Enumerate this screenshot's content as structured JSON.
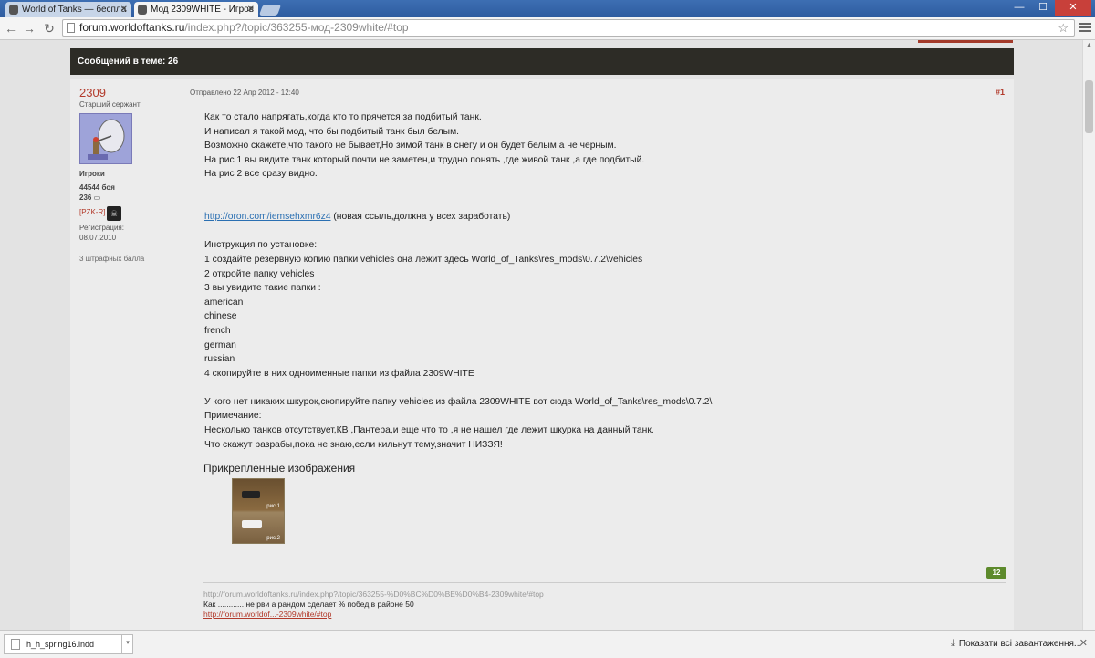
{
  "browser": {
    "tabs": [
      {
        "title": "World of Tanks — беспла",
        "active": false
      },
      {
        "title": "Мод 2309WHITE - Игров",
        "active": true
      }
    ],
    "url_domain": "forum.worldoftanks.ru",
    "url_path": "/index.php?/topic/363255-мод-2309white/#top",
    "window_controls": {
      "minimize": "—",
      "maximize": "☐",
      "close": "✕"
    }
  },
  "topic_header": {
    "replies_label": "Сообщений в теме: 26"
  },
  "post": {
    "author": "2309",
    "rank": "Старший сержант",
    "group": "Игроки",
    "battles": "44544 боя",
    "posts_count": "236",
    "clan_tag": "[PZK-R]",
    "clan_logo": "☠",
    "registered_label": "Регистрация:",
    "registered_date": "08.07.2010",
    "penalty": "3 штрафных балла",
    "posted": "Отправлено 22 Апр 2012 - 12:40",
    "number": "#1",
    "body": {
      "p1": "Как то стало напрягать,когда кто то прячется за подбитый танк.",
      "p2": "И написал я такой мод, что бы подбитый танк был белым.",
      "p3": "Возможно скажете,что такого не бывает,Но зимой танк в снегу и он будет белым а не черным.",
      "p4": "На рис 1 вы видите танк который почти не заметен,и трудно понять ,где живой танк ,а где подбитый.",
      "p5": "На рис 2 все сразу видно.",
      "link": "http://oron.com/iemsehxmr6z4",
      "link_note": "(новая ссыль,должна у всех заработать)",
      "install_title": "Инструкция по установке:",
      "step1": "1 создайте резервную копию папки vehicles  она лежит здесь World_of_Tanks\\res_mods\\0.7.2\\vehicles",
      "step2": "2 откройте папку vehicles",
      "step3": "3 вы увидите такие папки :",
      "folders": [
        "american",
        "chinese",
        "french",
        "german",
        "russian"
      ],
      "step4": "4 скопируйте в них одноименные папки из файла  2309WHITE",
      "no_skins": "У кого нет никаких шкурок,скопируйте папку vehicles из файла  2309WHITE  вот сюда World_of_Tanks\\res_mods\\0.7.2\\",
      "note_title": "Примечание:",
      "note1": "Несколько танков отсутствует,КВ ,Пантера,и еще что то ,я не нашел где лежит шкурка на данный танк.",
      "note2": "Что скажут разрабы,пока не знаю,если кильнут тему,значит НИЗЗЯ!"
    },
    "attachments_title": "Прикрепленные изображения",
    "thumb_label1": "рис.1",
    "thumb_label2": "рис.2",
    "reputation": "12",
    "signature": {
      "url": "http://forum.worldoftanks.ru/index.php?/topic/363255-%D0%BC%D0%BE%D0%B4-2309white/#top",
      "text": "Как ............ не рви а рандом сделает % побед в районе 50",
      "link": "http://forum.worldof...-2309white/#top"
    }
  },
  "downloads": {
    "file": "h_h_spring16.indd",
    "show_all": "Показати всі завантаження..."
  },
  "colors": {
    "accent_red": "#b23a2b",
    "header_dark": "#2d2c26",
    "rep_green": "#5d8a2c",
    "link_blue": "#2a6fb2"
  }
}
